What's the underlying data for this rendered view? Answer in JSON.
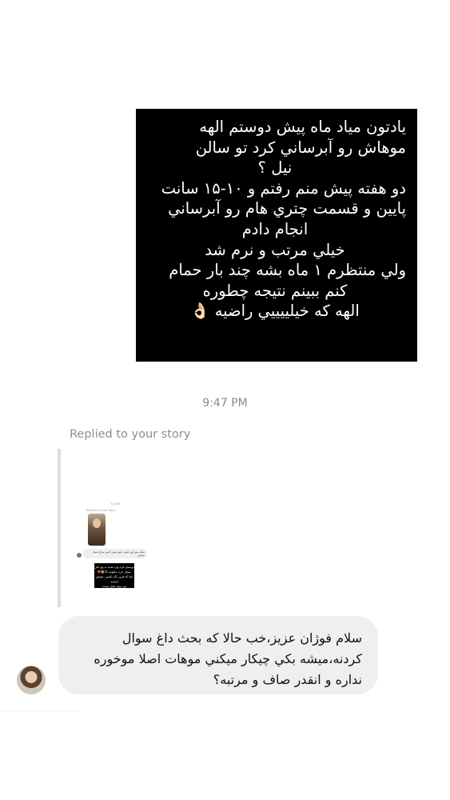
{
  "forwarded_message": {
    "lines": [
      "يادتون مياد ماه پيش دوستم الهه",
      "موهاش رو آبرساني كرد تو سالن",
      "نيل ؟",
      "دو هفته پيش منم رفتم و ۱۰-۱۵ سانت",
      "پايين و قسمت چتري هام رو آبرساني",
      "انجام دادم",
      "خيلي مرتب و نرم شد",
      "ولي منتظرم ۱ ماه بشه چند بار حمام",
      "كنم ببينم نتيجه چطوره",
      "الهه كه خيلييييي راضيه 👌🏻"
    ]
  },
  "timestamp": "9:47 PM",
  "reply_label": "Replied to your story",
  "story_preview": {
    "top_text": "ELAHE",
    "sub_text": "Replied to your story",
    "gray_text": "سلام پس اون فوتي خوبه پيش كدوم مزاج شمل ميشي",
    "black_text_lines": [
      "دوستان تازه وارد شده به پيج كلي",
      "سوال دارن معلومه 😊🤩❤️",
      "اولا كه فرين نگه نكنيين ،خونش اومدید",
      "من ببینم عمل نیست"
    ]
  },
  "incoming_message": {
    "lines": [
      "سلام فوژان عزيز،خب حالا كه بحث داغ سوال",
      "كردنه،ميشه بكي چيكار ميكني موهات اصلا موخوره",
      "نداره و انقدر صاف و مرتبه؟"
    ]
  }
}
